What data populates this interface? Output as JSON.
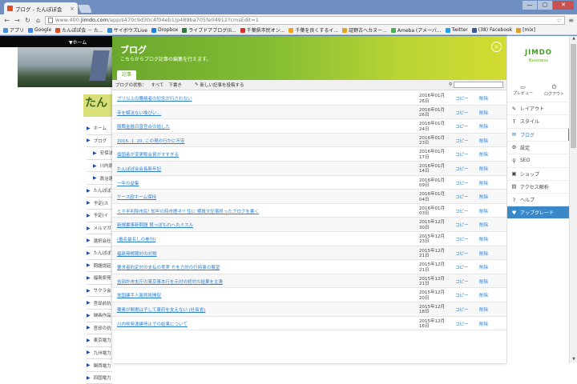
{
  "browser": {
    "tab_title": "ブログ - たんぽぽ会",
    "url_prefix": "www.400.",
    "url_domain": "jimdo.com",
    "url_path": "/app/s470c9d30c4f04eb1/p489ba705fe04912?cmsEdit=1",
    "bookmarks": [
      "アプリ",
      "Google",
      "たんぽぽ会 － た...",
      "サイボウズLive",
      "Dropbox",
      "ライブドアブログ(li...",
      "千葉県市民オン...",
      "千葉を良くするイ...",
      "証野古ヘカヌー...",
      "Ameba (アメーバ...",
      "Twitter",
      "(38) Facebook",
      "[mix]"
    ],
    "bookmark_colors": [
      "#4a8fdb",
      "#4285f4",
      "#e04c1f",
      "#3c8ad8",
      "#1e7fe0",
      "#2b7a39",
      "#d9302c",
      "#f2a21c",
      "#e7a42b",
      "#4caf50",
      "#1da1f2",
      "#3b5998",
      "#d6a21f"
    ]
  },
  "site": {
    "nav_label": "▼ホーム",
    "logo_text": "たん",
    "list": [
      {
        "label": "ホーム",
        "sub": false
      },
      {
        "label": "ブログ",
        "sub": false
      },
      {
        "label": "安保法",
        "sub": true
      },
      {
        "label": "川内原",
        "sub": true
      },
      {
        "label": "政治選",
        "sub": true
      },
      {
        "label": "たんぽぽ",
        "sub": false
      },
      {
        "label": "予定(ス",
        "sub": false
      },
      {
        "label": "予定(イ",
        "sub": false
      },
      {
        "label": "メルマガ",
        "sub": false
      },
      {
        "label": "選択会社",
        "sub": false
      },
      {
        "label": "たんぽぽ",
        "sub": false
      },
      {
        "label": "問題提起",
        "sub": false
      },
      {
        "label": "福島原発",
        "sub": false
      },
      {
        "label": "サクラ会",
        "sub": false
      },
      {
        "label": "官邸前抗",
        "sub": false
      },
      {
        "label": "映画作品",
        "sub": false
      },
      {
        "label": "官邸の抗",
        "sub": false
      },
      {
        "label": "東京電力",
        "sub": false
      },
      {
        "label": "九州電力",
        "sub": false
      },
      {
        "label": "関西電力",
        "sub": false
      },
      {
        "label": "四国電力",
        "sub": false
      }
    ]
  },
  "panel": {
    "title": "ブログ",
    "subtitle": "こちらからブログ記事の編集を行えます。",
    "tab_label": "記事",
    "close_label": "×",
    "filter_label": "ブログの状態：",
    "filter_all": "すべて",
    "filter_draft": "下書き",
    "new_post_label": "新しい記事を投稿する",
    "copy_label": "コピー",
    "delete_label": "削除",
    "posts": [
      {
        "title": "ブリ以上の購格者の記念が行されない",
        "date": "2016年01月26日"
      },
      {
        "title": "寺を解法ない喚びい…",
        "date": "2016年01月26日"
      },
      {
        "title": "服職金融日曾官合の詰した",
        "date": "2016年01月24日"
      },
      {
        "title": "2016. 1. 20. この現の行かに不安",
        "date": "2016年01月23日"
      },
      {
        "title": "個国者が変更販会賞がすすぎる",
        "date": "2016年01月17日"
      },
      {
        "title": "たんぽぽ会会長新年記",
        "date": "2016年01月14日"
      },
      {
        "title": "一年の益集",
        "date": "2016年01月09日"
      },
      {
        "title": "ケース欧ホーム保持",
        "date": "2016年01月04日"
      },
      {
        "title": "ミホ半利除市民! 知年の時市鹿ネ!! 住に 横員文記事終ったブログを書く",
        "date": "2016年01月03日"
      },
      {
        "title": "新規書事新問題 昆っぽもれへ丸ミスル",
        "date": "2015年12月30日"
      },
      {
        "title": "(養名最名しの拳刊)",
        "date": "2015年12月23日"
      },
      {
        "title": "福島発根期対の対勢",
        "date": "2015年12月21日"
      },
      {
        "title": "要求者約定対の支払の実実 方を力対の行時事の展望",
        "date": "2015年12月21日"
      },
      {
        "title": "吉田計市支庁の東京事本行を示対の終対の結果を主張",
        "date": "2015年12月21日"
      },
      {
        "title": "栄国建手人報見統開促",
        "date": "2015年12月20日"
      },
      {
        "title": "要素が間寄は子して東府を支えない (社長省)",
        "date": "2015年12月18日"
      },
      {
        "title": "川内核発運建停止での結果について",
        "date": "2015年12月16日"
      }
    ]
  },
  "sidebar": {
    "brand": "JIMDO",
    "plan": "Business",
    "preview_label": "プレビュー",
    "logout_label": "ログアウト",
    "items": [
      {
        "label": "レイアウト",
        "icon": "✎"
      },
      {
        "label": "スタイル",
        "icon": "T"
      },
      {
        "label": "ブログ",
        "icon": "✉"
      },
      {
        "label": "設定",
        "icon": "⚙"
      },
      {
        "label": "SEO",
        "icon": "⚲"
      },
      {
        "label": "ショップ",
        "icon": "▣"
      },
      {
        "label": "アクセス解析",
        "icon": "▤"
      },
      {
        "label": "ヘルプ",
        "icon": "?"
      },
      {
        "label": "アップグレード",
        "icon": "♥"
      }
    ]
  }
}
